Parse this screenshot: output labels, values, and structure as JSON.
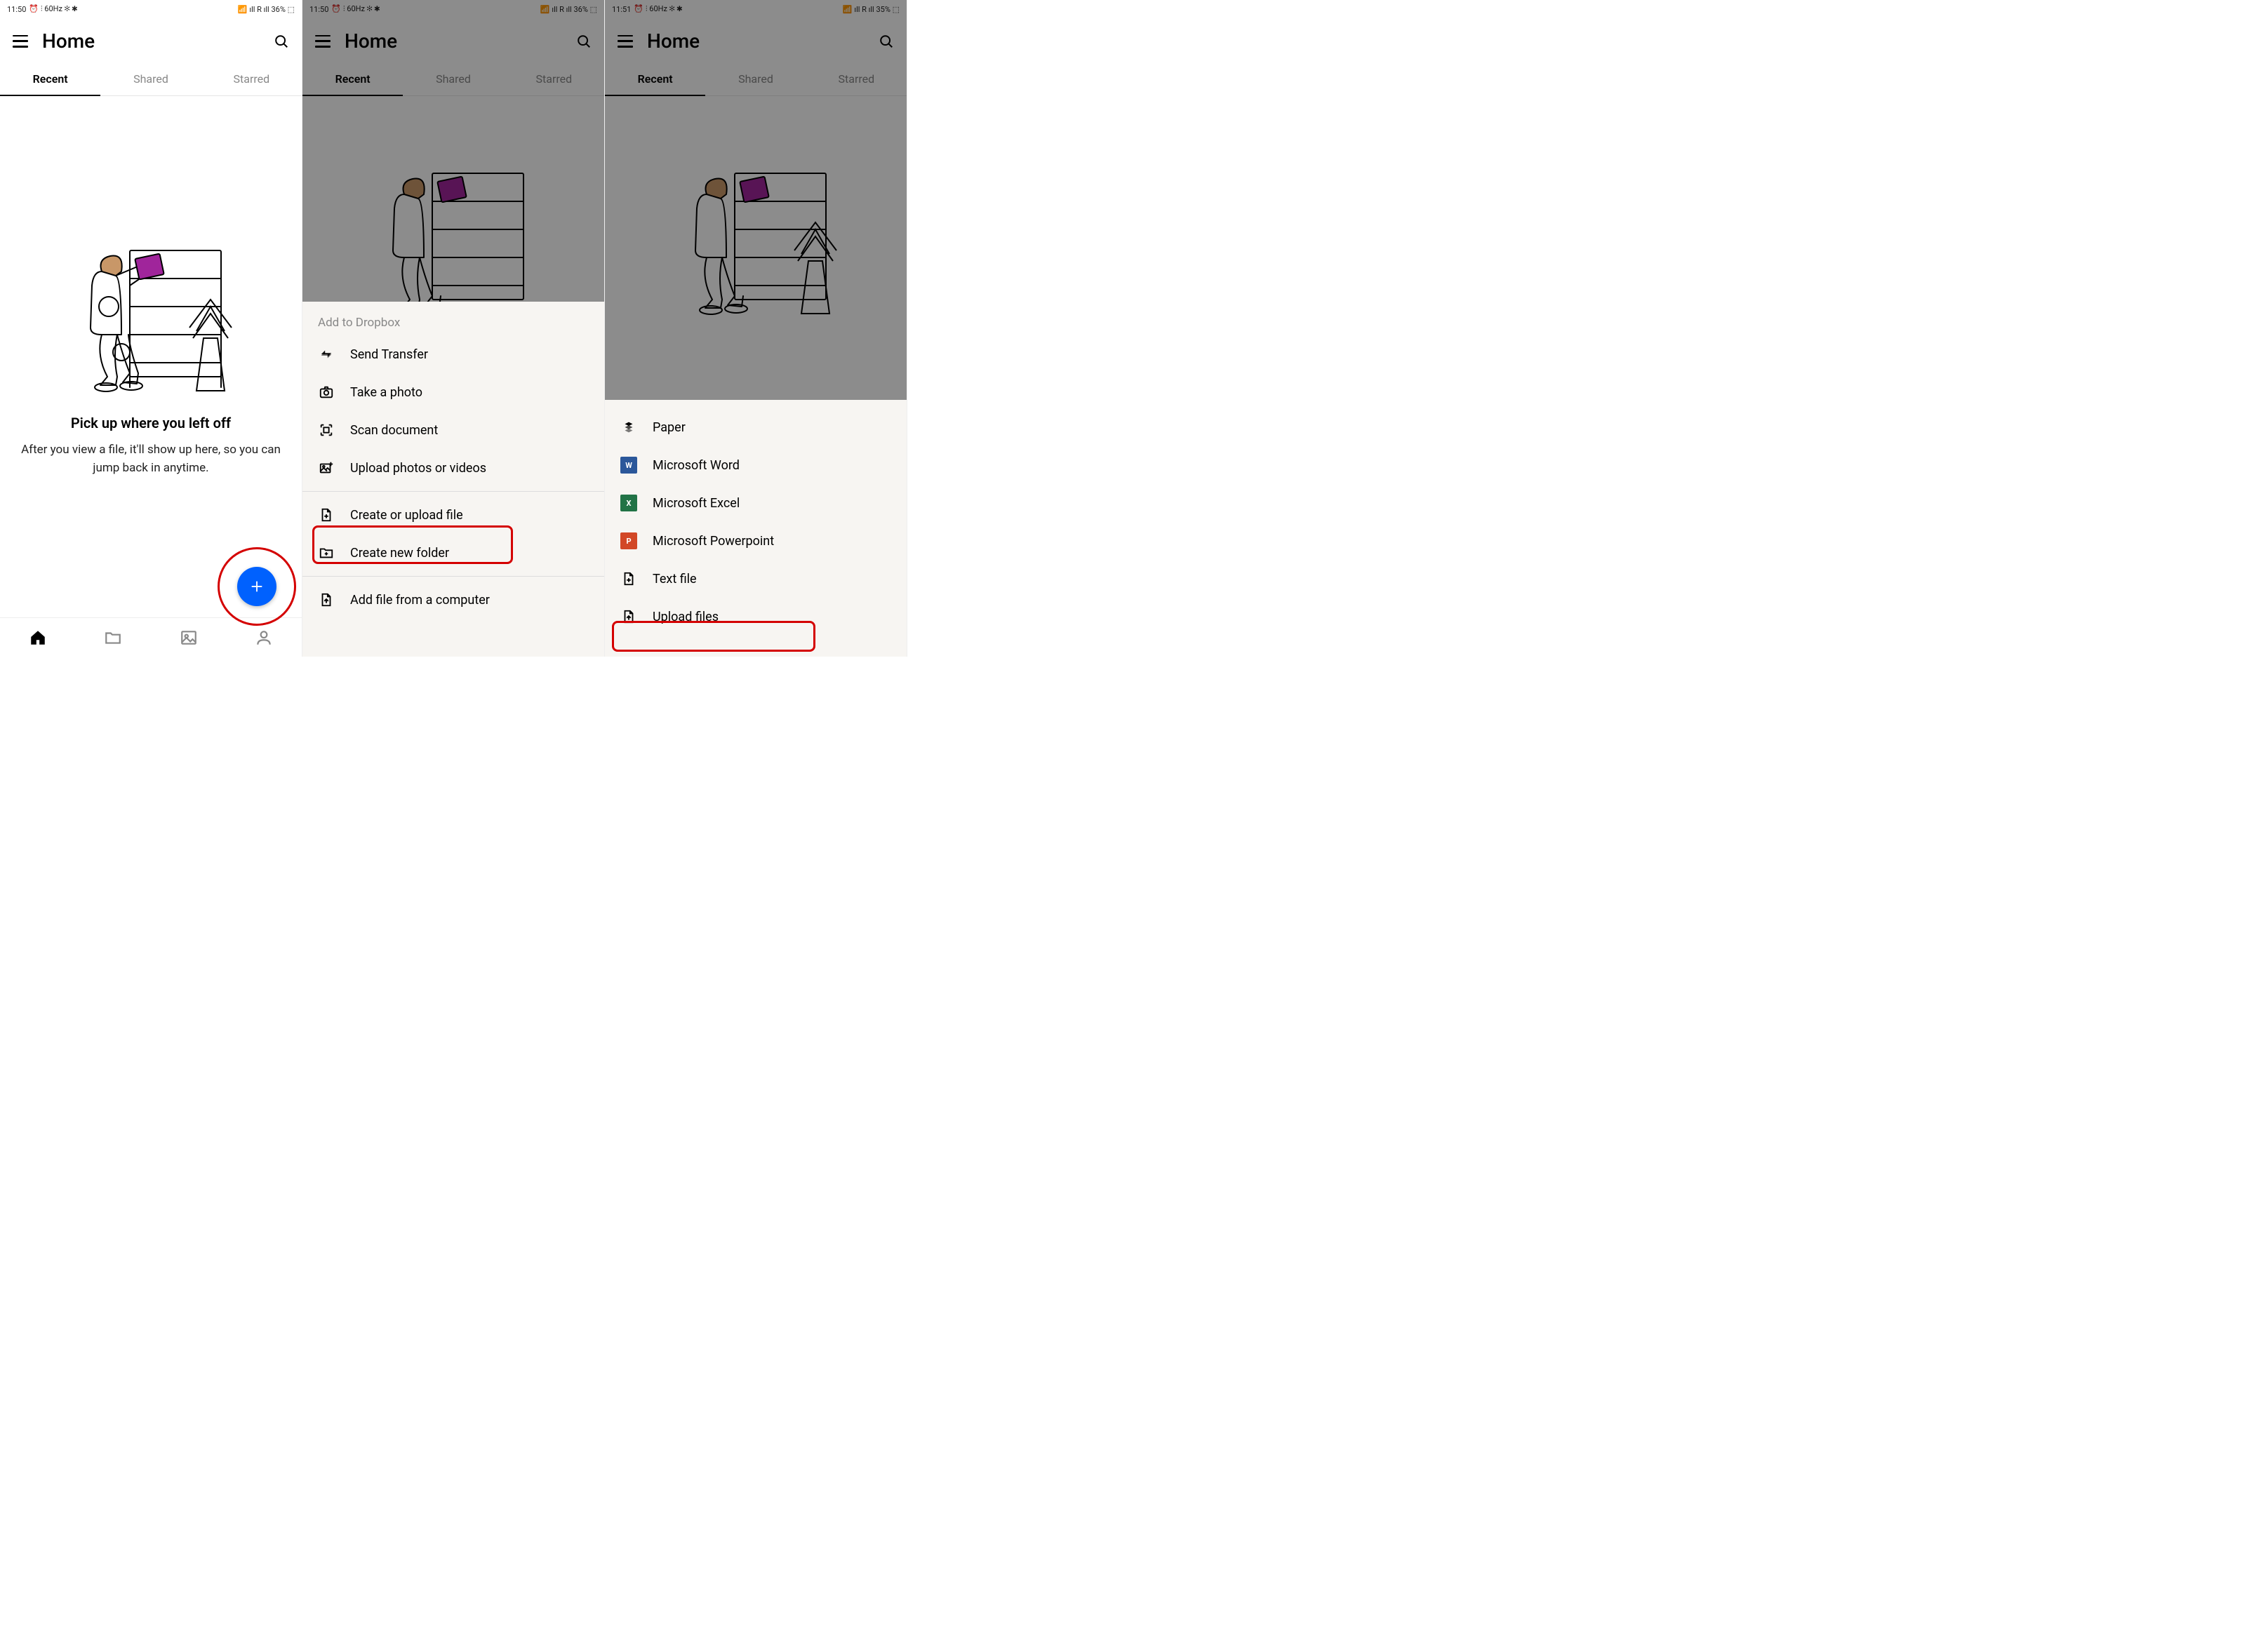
{
  "screens": [
    {
      "status": {
        "time": "11:50",
        "indicators": "⏰ ⫶ 60Hz ✻ ✱",
        "right": "📶 ıll R ıll 36% ⬚"
      },
      "battery": "36%"
    },
    {
      "status": {
        "time": "11:50",
        "indicators": "⏰ ⫶ 60Hz ✻ ✱",
        "right": "📶 ıll R ıll 36% ⬚"
      },
      "battery": "36%"
    },
    {
      "status": {
        "time": "11:51",
        "indicators": "⏰ ⫶ 60Hz ✻ ✱",
        "right": "📶 ıll R ıll 35% ⬚"
      },
      "battery": "35%"
    }
  ],
  "header": {
    "title": "Home"
  },
  "tabs": {
    "recent": "Recent",
    "shared": "Shared",
    "starred": "Starred"
  },
  "empty": {
    "title": "Pick up where you left off",
    "body": "After you view a file, it'll show up here, so you can jump back in anytime."
  },
  "sheet1": {
    "title": "Add to Dropbox",
    "items": [
      {
        "icon": "transfer",
        "label": "Send Transfer"
      },
      {
        "icon": "camera",
        "label": "Take a photo"
      },
      {
        "icon": "scan",
        "label": "Scan document"
      },
      {
        "icon": "upload-media",
        "label": "Upload photos or videos"
      },
      {
        "icon": "file-plus",
        "label": "Create or upload file",
        "highlight": true
      },
      {
        "icon": "folder-plus",
        "label": "Create new folder"
      },
      {
        "icon": "computer-file",
        "label": "Add file from a computer"
      }
    ]
  },
  "sheet2": {
    "items": [
      {
        "icon": "paper",
        "label": "Paper"
      },
      {
        "icon": "word",
        "label": "Microsoft Word"
      },
      {
        "icon": "excel",
        "label": "Microsoft Excel"
      },
      {
        "icon": "ppt",
        "label": "Microsoft Powerpoint"
      },
      {
        "icon": "text-file",
        "label": "Text file"
      },
      {
        "icon": "upload-files",
        "label": "Upload files",
        "highlight": true
      }
    ]
  }
}
